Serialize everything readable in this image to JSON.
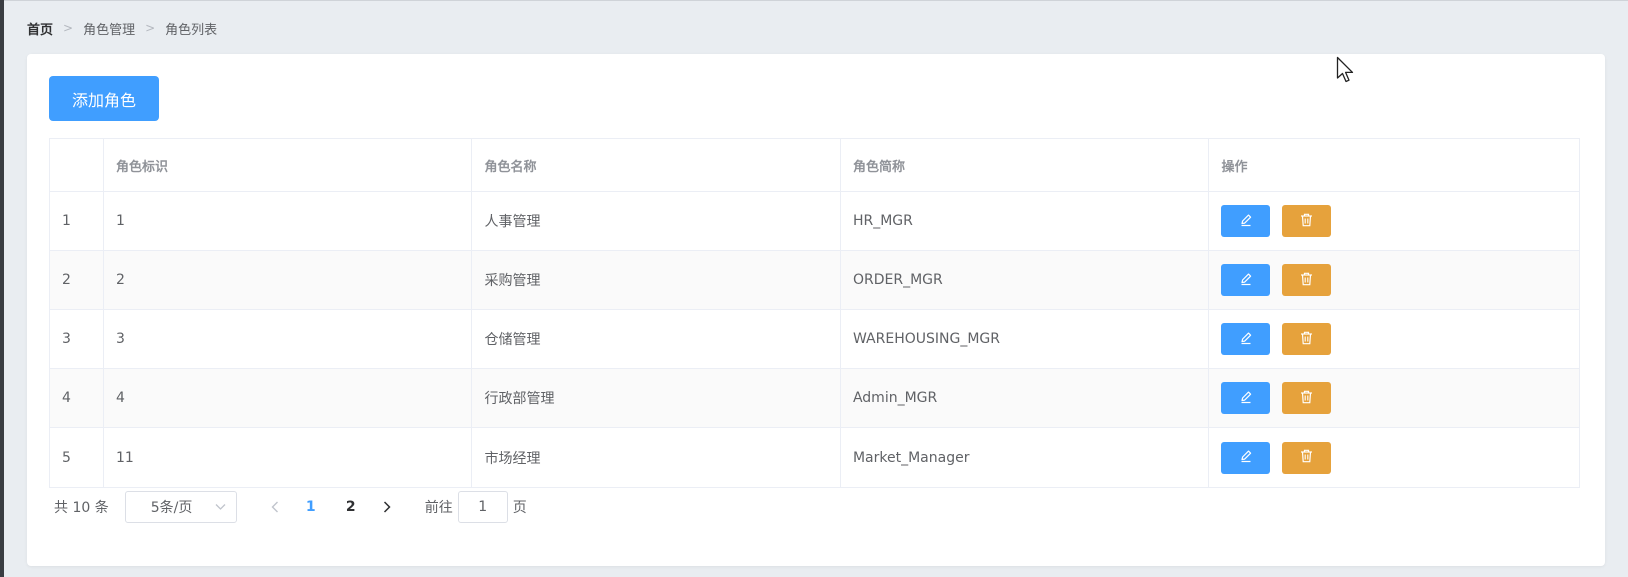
{
  "breadcrumb": [
    "首页",
    "角色管理",
    "角色列表"
  ],
  "toolbar": {
    "add_label": "添加角色"
  },
  "table": {
    "headers": [
      "",
      "角色标识",
      "角色名称",
      "角色简称",
      "操作"
    ],
    "rows": [
      {
        "index": "1",
        "id": "1",
        "name": "人事管理",
        "short": "HR_MGR"
      },
      {
        "index": "2",
        "id": "2",
        "name": "采购管理",
        "short": "ORDER_MGR"
      },
      {
        "index": "3",
        "id": "3",
        "name": "仓储管理",
        "short": "WAREHOUSING_MGR"
      },
      {
        "index": "4",
        "id": "4",
        "name": "行政部管理",
        "short": "Admin_MGR"
      },
      {
        "index": "5",
        "id": "11",
        "name": "市场经理",
        "short": "Market_Manager"
      }
    ],
    "edit_icon": "edit-icon",
    "delete_icon": "delete-icon"
  },
  "pagination": {
    "total_text": "共 10 条",
    "page_size": "5条/页",
    "pages": [
      "1",
      "2"
    ],
    "current_page": "1",
    "goto_prefix": "前往",
    "goto_value": "1",
    "goto_suffix": "页"
  },
  "colors": {
    "primary": "#409eff",
    "warning": "#e6a23c"
  }
}
